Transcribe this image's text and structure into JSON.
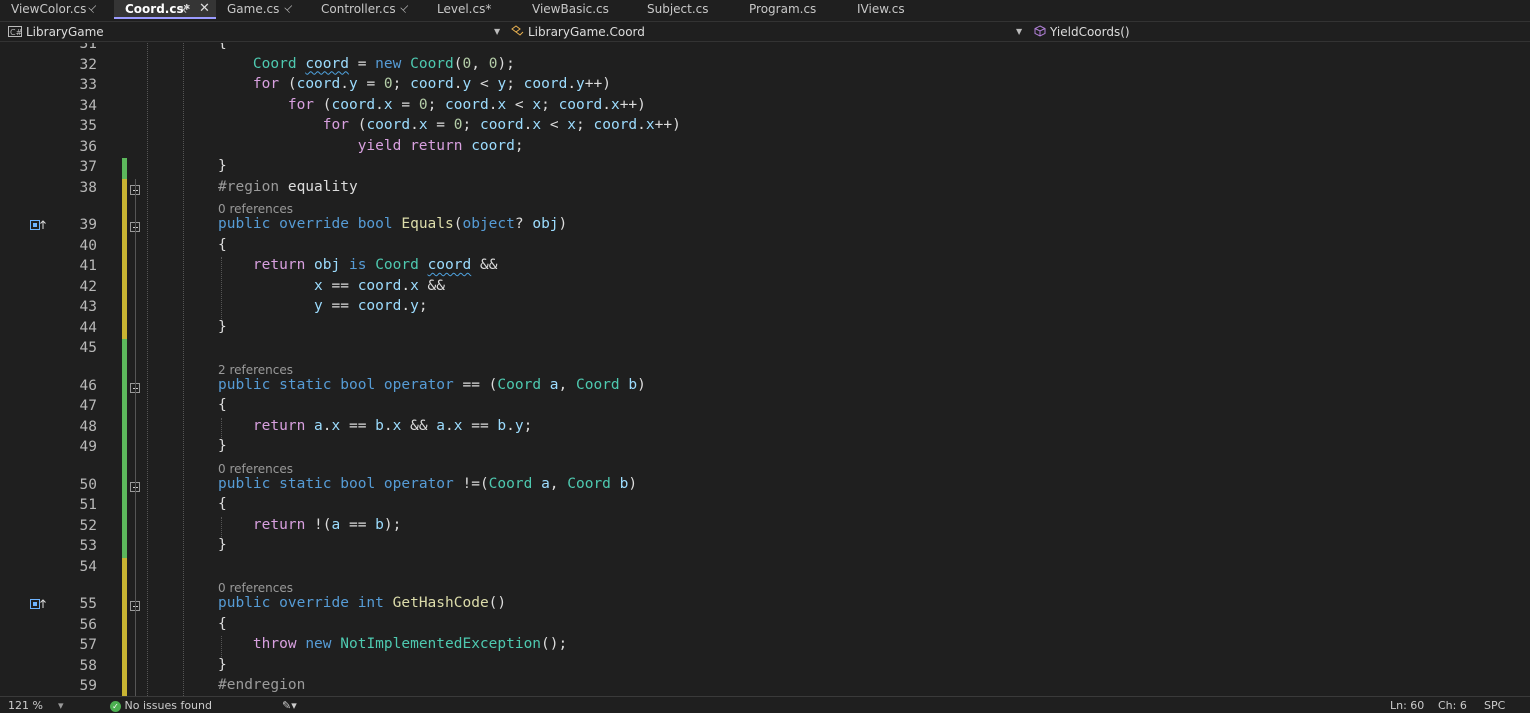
{
  "tabs": [
    {
      "label": "ViewColor.cs",
      "pinned": true,
      "active": false,
      "width": 114
    },
    {
      "label": "Coord.cs*",
      "pinned": true,
      "active": true,
      "closable": true,
      "width": 102
    },
    {
      "label": "Game.cs",
      "pinned": true,
      "active": false,
      "width": 94
    },
    {
      "label": "Controller.cs",
      "pinned": true,
      "active": false,
      "width": 116
    },
    {
      "label": "Level.cs*",
      "pinned": false,
      "active": false,
      "width": 95
    },
    {
      "label": "ViewBasic.cs",
      "pinned": false,
      "active": false,
      "width": 115
    },
    {
      "label": "Subject.cs",
      "pinned": false,
      "active": false,
      "width": 102
    },
    {
      "label": "Program.cs",
      "pinned": false,
      "active": false,
      "width": 108
    },
    {
      "label": "IView.cs",
      "pinned": false,
      "active": false,
      "width": 86
    }
  ],
  "nav": {
    "project": "LibraryGame",
    "type": "LibraryGame.Coord",
    "member": "YieldCoords()"
  },
  "code": {
    "lines": [
      {
        "n": "31",
        "html": "{"
      },
      {
        "n": "32",
        "html": "    <span class=\"ty\">Coord</span> <span class=\"var squig\">coord</span> = <span class=\"kw\">new</span> <span class=\"ty\">Coord</span>(<span class=\"num\">0</span>, <span class=\"num\">0</span>);"
      },
      {
        "n": "33",
        "html": "    <span class=\"ctl\">for</span> (<span class=\"var\">coord</span>.<span class=\"var\">y</span> = <span class=\"num\">0</span>; <span class=\"var\">coord</span>.<span class=\"var\">y</span> &lt; <span class=\"var\">y</span>; <span class=\"var\">coord</span>.<span class=\"var\">y</span>++)"
      },
      {
        "n": "34",
        "html": "        <span class=\"ctl\">for</span> (<span class=\"var\">coord</span>.<span class=\"var\">x</span> = <span class=\"num\">0</span>; <span class=\"var\">coord</span>.<span class=\"var\">x</span> &lt; <span class=\"var\">x</span>; <span class=\"var\">coord</span>.<span class=\"var\">x</span>++)"
      },
      {
        "n": "35",
        "html": "            <span class=\"ctl\">for</span> (<span class=\"var\">coord</span>.<span class=\"var\">x</span> = <span class=\"num\">0</span>; <span class=\"var\">coord</span>.<span class=\"var\">x</span> &lt; <span class=\"var\">x</span>; <span class=\"var\">coord</span>.<span class=\"var\">x</span>++)"
      },
      {
        "n": "36",
        "html": "                <span class=\"ctl\">yield return</span> <span class=\"var\">coord</span>;"
      },
      {
        "n": "37",
        "html": "}"
      },
      {
        "n": "38",
        "html": "<span class=\"pre\">#region</span> equality"
      },
      {
        "lens": "0 references"
      },
      {
        "n": "39",
        "html": "<span class=\"kw\">public</span> <span class=\"kw\">override</span> <span class=\"kw\">bool</span> <span class=\"fn\">Equals</span>(<span class=\"kw\">object</span>? <span class=\"var\">obj</span>)"
      },
      {
        "n": "40",
        "html": "{"
      },
      {
        "n": "41",
        "html": "    <span class=\"ctl\">return</span> <span class=\"var\">obj</span> <span class=\"kw\">is</span> <span class=\"ty\">Coord</span> <span class=\"var squig\">coord</span> &amp;&amp;"
      },
      {
        "n": "42",
        "html": "           <span class=\"var\">x</span> == <span class=\"var\">coord</span>.<span class=\"var\">x</span> &amp;&amp;"
      },
      {
        "n": "43",
        "html": "           <span class=\"var\">y</span> == <span class=\"var\">coord</span>.<span class=\"var\">y</span>;"
      },
      {
        "n": "44",
        "html": "}"
      },
      {
        "n": "45",
        "html": ""
      },
      {
        "lens": "2 references"
      },
      {
        "n": "46",
        "html": "<span class=\"kw\">public</span> <span class=\"kw\">static</span> <span class=\"kw\">bool</span> <span class=\"kw\">operator</span> == (<span class=\"ty\">Coord</span> <span class=\"var\">a</span>, <span class=\"ty\">Coord</span> <span class=\"var\">b</span>)"
      },
      {
        "n": "47",
        "html": "{"
      },
      {
        "n": "48",
        "html": "    <span class=\"ctl\">return</span> <span class=\"var\">a</span>.<span class=\"var\">x</span> == <span class=\"var\">b</span>.<span class=\"var\">x</span> &amp;&amp; <span class=\"var\">a</span>.<span class=\"var\">x</span> == <span class=\"var\">b</span>.<span class=\"var\">y</span>;"
      },
      {
        "n": "49",
        "html": "}"
      },
      {
        "lens": "0 references"
      },
      {
        "n": "50",
        "html": "<span class=\"kw\">public</span> <span class=\"kw\">static</span> <span class=\"kw\">bool</span> <span class=\"kw\">operator</span> !=(<span class=\"ty\">Coord</span> <span class=\"var\">a</span>, <span class=\"ty\">Coord</span> <span class=\"var\">b</span>)"
      },
      {
        "n": "51",
        "html": "{"
      },
      {
        "n": "52",
        "html": "    <span class=\"ctl\">return</span> !(<span class=\"var\">a</span> == <span class=\"var\">b</span>);"
      },
      {
        "n": "53",
        "html": "}"
      },
      {
        "n": "54",
        "html": ""
      },
      {
        "lens": "0 references"
      },
      {
        "n": "55",
        "html": "<span class=\"kw\">public</span> <span class=\"kw\">override</span> <span class=\"kw\">int</span> <span class=\"fn\">GetHashCode</span>()"
      },
      {
        "n": "56",
        "html": "{"
      },
      {
        "n": "57",
        "html": "    <span class=\"ctl\">throw</span> <span class=\"kw\">new</span> <span class=\"ty\">NotImplementedException</span>();"
      },
      {
        "n": "58",
        "html": "}"
      },
      {
        "n": "59",
        "html": "<span class=\"pre\">#endregion</span>"
      },
      {
        "n": "60",
        "html": "}"
      }
    ]
  },
  "status": {
    "zoom": "121 %",
    "issues": "No issues found",
    "ln": "Ln: 60",
    "ch": "Ch: 6",
    "enc": "SPC"
  },
  "colors": {
    "accent": "#9b9bff",
    "saved_change": "#5cb85c",
    "unsaved_change": "#c8b432"
  }
}
